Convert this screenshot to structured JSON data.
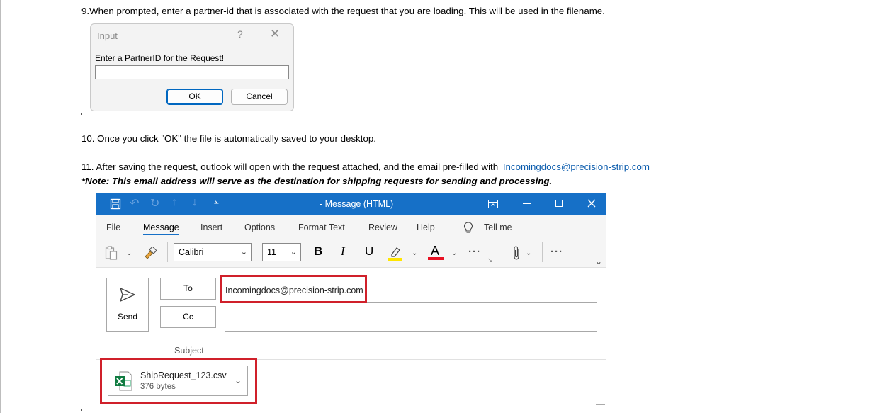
{
  "doc": {
    "step9": "9.When prompted, enter a partner-id that is associated with the request that you are loading. This will be used in the filename.",
    "step10": "10. Once you click \"OK\" the file is automatically saved to your desktop.",
    "step11_prefix": "11. After saving the request, outlook will open with the request attached, and the email pre-filled with",
    "step11_link": "Incomingdocs@precision-strip.com",
    "note": "*Note: This email address will serve as the destination for shipping requests for sending and processing."
  },
  "dialog": {
    "title": "Input",
    "help": "?",
    "close": "✕",
    "prompt": "Enter a PartnerID for the Request!",
    "input_value": "",
    "ok_label": "OK",
    "cancel_label": "Cancel"
  },
  "outlook": {
    "window_title": "-  Message (HTML)",
    "menu": [
      "File",
      "Message",
      "Insert",
      "Options",
      "Format Text",
      "Review",
      "Help"
    ],
    "active_menu": "Message",
    "tell_me": "Tell me",
    "font_name": "Calibri",
    "font_size": "11",
    "format": {
      "bold": "B",
      "italic": "I",
      "underline": "U",
      "font_color": "A"
    },
    "send_label": "Send",
    "to_label": "To",
    "cc_label": "Cc",
    "to_value": "Incomingdocs@precision-strip.com",
    "subject_label": "Subject",
    "attachment": {
      "name": "ShipRequest_123.csv",
      "size": "376 bytes"
    }
  },
  "colors": {
    "titlebar": "#1670c7",
    "highlight_box": "#d0202a",
    "link": "#0b5cad",
    "excel_green": "#107c41",
    "highlighter_yellow": "#ffe500",
    "font_color_red": "#e81123"
  },
  "icons": [
    "save-icon",
    "undo-icon",
    "redo-icon",
    "up-icon",
    "down-icon",
    "customize-icon",
    "ribbon-display-icon",
    "minimize-icon",
    "maximize-icon",
    "close-icon",
    "lightbulb-icon",
    "paste-icon",
    "format-painter-icon",
    "highlighter-icon",
    "font-color-icon",
    "more-icon",
    "attach-icon",
    "send-icon",
    "excel-icon",
    "chevron-down-icon"
  ]
}
